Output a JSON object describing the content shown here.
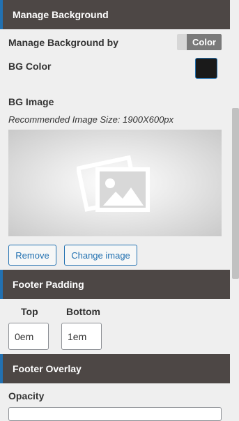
{
  "manage_background": {
    "header": "Manage Background",
    "by_label": "Manage Background by",
    "toggle_value": "Color",
    "bg_color_label": "BG Color",
    "bg_color_value": "#1a1a1a",
    "bg_image_label": "BG Image",
    "recommended_text": "Recommended Image Size: 1900X600px",
    "remove_label": "Remove",
    "change_label": "Change image",
    "placeholder_icon": "image-placeholder-icon"
  },
  "footer_padding": {
    "header": "Footer Padding",
    "top_label": "Top",
    "bottom_label": "Bottom",
    "top_value": "0em",
    "bottom_value": "1em"
  },
  "footer_overlay": {
    "header": "Footer Overlay",
    "opacity_label": "Opacity"
  },
  "colors": {
    "header_bg": "#4d4745",
    "accent": "#2271b1"
  }
}
